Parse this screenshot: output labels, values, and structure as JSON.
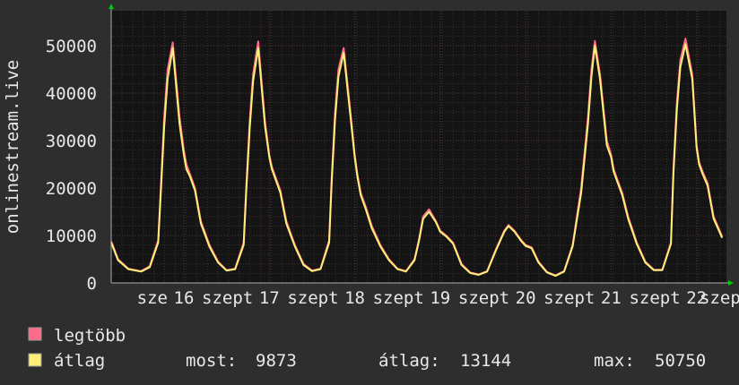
{
  "colors": {
    "background": "#2e2e2e",
    "canvas": "#141414",
    "grid_minor": "#3a3030",
    "grid_major": "#5a3a3a",
    "text": "#e8e8e8",
    "max_line": "#ff6b8a",
    "avg_line": "#ffee77",
    "arrow": "#00cc00"
  },
  "chart_data": {
    "type": "line",
    "ylabel": "onlinestream.live",
    "ylim": [
      0,
      50000
    ],
    "yticks": [
      0,
      10000,
      20000,
      30000,
      40000,
      50000
    ],
    "ytick_labels": [
      "0",
      "10000",
      "20000",
      "30000",
      "40000",
      "50000"
    ],
    "xlim": [
      0,
      7.2
    ],
    "xticks": [
      {
        "pos": 0.85,
        "left": "sze",
        "num": "16"
      },
      {
        "pos": 1.85,
        "left": "szept",
        "num": "17"
      },
      {
        "pos": 2.85,
        "left": "szept",
        "num": "18"
      },
      {
        "pos": 3.85,
        "left": "szept",
        "num": "19"
      },
      {
        "pos": 4.85,
        "left": "szept",
        "num": "20"
      },
      {
        "pos": 5.85,
        "left": "szept",
        "num": "21"
      },
      {
        "pos": 6.85,
        "left": "szept",
        "num": "22"
      }
    ],
    "xtick_trailing": "szep",
    "series": [
      {
        "name": "legtöbb",
        "color": "#ff6b8a",
        "x": [
          0,
          0.08,
          0.2,
          0.35,
          0.45,
          0.55,
          0.58,
          0.62,
          0.66,
          0.72,
          0.8,
          0.85,
          0.88,
          0.92,
          0.98,
          1.05,
          1.15,
          1.25,
          1.35,
          1.45,
          1.55,
          1.58,
          1.62,
          1.66,
          1.72,
          1.8,
          1.85,
          1.88,
          1.92,
          1.98,
          2.05,
          2.15,
          2.25,
          2.35,
          2.45,
          2.55,
          2.58,
          2.62,
          2.66,
          2.72,
          2.8,
          2.85,
          2.88,
          2.92,
          2.98,
          3.05,
          3.15,
          3.25,
          3.35,
          3.45,
          3.55,
          3.6,
          3.65,
          3.72,
          3.8,
          3.85,
          3.92,
          4.0,
          4.1,
          4.2,
          4.3,
          4.4,
          4.5,
          4.6,
          4.65,
          4.72,
          4.8,
          4.85,
          4.92,
          5.0,
          5.1,
          5.2,
          5.3,
          5.4,
          5.5,
          5.58,
          5.62,
          5.66,
          5.72,
          5.8,
          5.85,
          5.88,
          5.92,
          5.98,
          6.05,
          6.15,
          6.25,
          6.35,
          6.45,
          6.55,
          6.58,
          6.62,
          6.66,
          6.72,
          6.8,
          6.85,
          6.88,
          6.92,
          6.98,
          7.05,
          7.15
        ],
        "y": [
          8800,
          5000,
          3000,
          2500,
          3500,
          9000,
          20000,
          35000,
          45000,
          50700,
          35000,
          28000,
          25000,
          23000,
          20000,
          13000,
          8000,
          4500,
          2700,
          3000,
          8500,
          20000,
          34000,
          44000,
          50900,
          34000,
          27000,
          24500,
          22500,
          19500,
          13000,
          8000,
          4000,
          2600,
          3000,
          9000,
          22000,
          36000,
          45000,
          49500,
          36000,
          27000,
          23000,
          19000,
          16000,
          12000,
          8000,
          5000,
          3000,
          2500,
          5000,
          9000,
          14000,
          15500,
          13000,
          11000,
          10000,
          8500,
          4000,
          2200,
          1800,
          2500,
          7000,
          11000,
          12200,
          11000,
          9000,
          8000,
          7500,
          4500,
          2300,
          1600,
          2500,
          8000,
          20000,
          35000,
          45000,
          51000,
          44000,
          30000,
          27000,
          24000,
          22000,
          19000,
          14000,
          8500,
          4500,
          2800,
          2800,
          8500,
          24000,
          38000,
          47000,
          51500,
          44000,
          29000,
          25500,
          23500,
          21000,
          14000,
          9800
        ]
      },
      {
        "name": "átlag",
        "color": "#ffee77",
        "x": [
          0,
          0.08,
          0.2,
          0.35,
          0.45,
          0.55,
          0.58,
          0.62,
          0.66,
          0.72,
          0.8,
          0.85,
          0.88,
          0.92,
          0.98,
          1.05,
          1.15,
          1.25,
          1.35,
          1.45,
          1.55,
          1.58,
          1.62,
          1.66,
          1.72,
          1.8,
          1.85,
          1.88,
          1.92,
          1.98,
          2.05,
          2.15,
          2.25,
          2.35,
          2.45,
          2.55,
          2.58,
          2.62,
          2.66,
          2.72,
          2.8,
          2.85,
          2.88,
          2.92,
          2.98,
          3.05,
          3.15,
          3.25,
          3.35,
          3.45,
          3.55,
          3.6,
          3.65,
          3.72,
          3.8,
          3.85,
          3.92,
          4.0,
          4.1,
          4.2,
          4.3,
          4.4,
          4.5,
          4.6,
          4.65,
          4.72,
          4.8,
          4.85,
          4.92,
          5.0,
          5.1,
          5.2,
          5.3,
          5.4,
          5.5,
          5.58,
          5.62,
          5.66,
          5.72,
          5.8,
          5.85,
          5.88,
          5.92,
          5.98,
          6.05,
          6.15,
          6.25,
          6.35,
          6.45,
          6.55,
          6.58,
          6.62,
          6.66,
          6.72,
          6.8,
          6.85,
          6.88,
          6.92,
          6.98,
          7.05,
          7.15
        ],
        "y": [
          8500,
          4800,
          2900,
          2400,
          3300,
          8500,
          19000,
          33000,
          43000,
          49500,
          33500,
          27000,
          24000,
          22500,
          19500,
          12500,
          7600,
          4300,
          2600,
          2900,
          8000,
          19000,
          32500,
          42500,
          49500,
          33000,
          26500,
          24000,
          22000,
          19000,
          12500,
          7700,
          3800,
          2500,
          2900,
          8500,
          21000,
          34500,
          43500,
          48500,
          35000,
          26500,
          22500,
          18500,
          15500,
          11500,
          7700,
          4800,
          2900,
          2400,
          4800,
          8700,
          13500,
          15000,
          12800,
          10800,
          9800,
          8300,
          3800,
          2100,
          1700,
          2400,
          6800,
          10800,
          12000,
          10800,
          8800,
          7800,
          7300,
          4300,
          2200,
          1500,
          2400,
          7700,
          19000,
          33500,
          43500,
          50000,
          43000,
          29000,
          26500,
          23500,
          21500,
          18500,
          13500,
          8200,
          4300,
          2700,
          2700,
          8200,
          23000,
          36500,
          45500,
          50300,
          43000,
          28500,
          25000,
          23000,
          20500,
          13500,
          9500
        ]
      }
    ],
    "legend": {
      "max_label": "legtöbb",
      "avg_label": "átlag",
      "stats": [
        {
          "label": "most:",
          "value": "9873"
        },
        {
          "label": "átlag:",
          "value": "13144"
        },
        {
          "label": "max:",
          "value": "50750"
        }
      ]
    }
  }
}
